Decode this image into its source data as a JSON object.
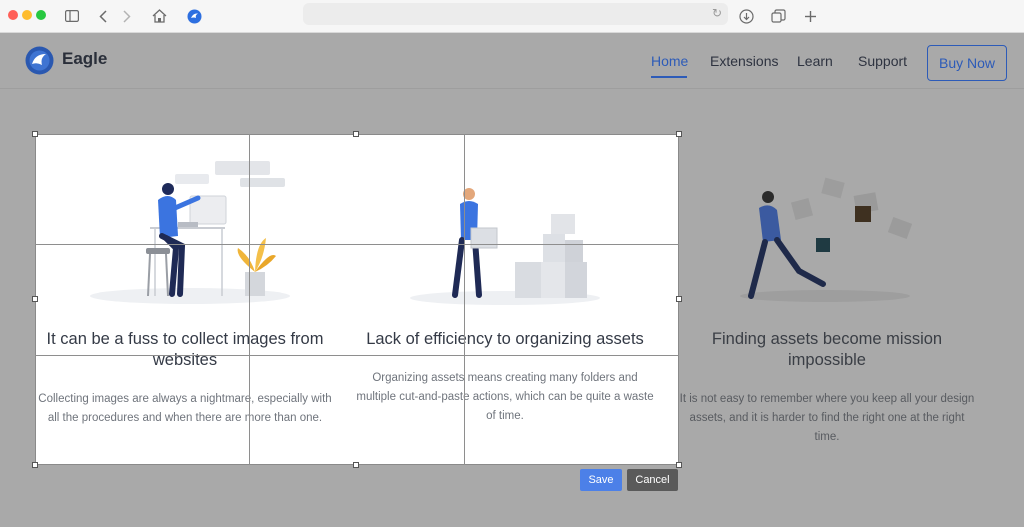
{
  "site": {
    "brand_name": "Eagle",
    "nav": {
      "home": "Home",
      "extensions": "Extensions",
      "learn": "Learn",
      "support": "Support",
      "buy": "Buy Now"
    }
  },
  "features": [
    {
      "title": "It can be a fuss to collect images from websites",
      "description": "Collecting images are always a nightmare, especially with all the procedures and when there are more than one."
    },
    {
      "title": "Lack of efficiency to organizing assets",
      "description": "Organizing assets means creating many folders and multiple cut-and-paste actions, which can be quite a waste of time."
    },
    {
      "title": "Finding assets become mission impossible",
      "description": "It is not easy to remember where you keep all your design assets, and it is harder to find the right one at the right time."
    }
  ],
  "crop_actions": {
    "save": "Save",
    "cancel": "Cancel"
  },
  "colors": {
    "accent": "#2d5bb8",
    "save_button": "#4c80e8",
    "cancel_button": "#5a5a5a",
    "overlay": "#a9a9a9"
  },
  "icons": [
    "sidebar-icon",
    "back-arrow-icon",
    "forward-arrow-icon",
    "home-icon",
    "eagle-favicon-icon",
    "reload-icon",
    "download-icon",
    "tabs-icon",
    "plus-icon",
    "eagle-logo-icon"
  ]
}
